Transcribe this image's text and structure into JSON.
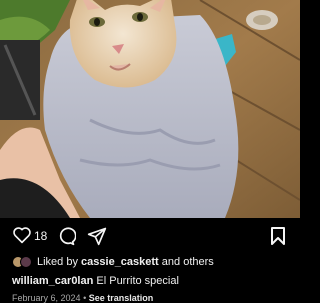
{
  "post": {
    "photo_alt": "",
    "like_count": "18",
    "liked_by_prefix": "Liked by",
    "liked_by_user": "cassie_caskett",
    "liked_by_suffix": "and others",
    "caption_user": "william_car0lan",
    "caption_text": "El Purrito special",
    "date": "February 6, 2024",
    "dot": "•",
    "see_translation": "See translation"
  },
  "icons": {
    "like": "heart-icon",
    "comment": "comment-icon",
    "share": "share-icon",
    "save": "bookmark-icon"
  },
  "colors": {
    "background": "#000000",
    "text": "#f5f5f5",
    "muted": "#a8a8a8"
  }
}
